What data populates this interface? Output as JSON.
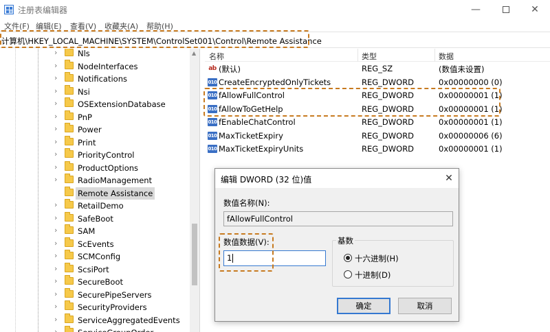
{
  "window": {
    "title": "注册表编辑器",
    "minimize": "—",
    "close": "✕"
  },
  "menu": [
    "文件(F)",
    "编辑(E)",
    "查看(V)",
    "收藏夹(A)",
    "帮助(H)"
  ],
  "address": "计算机\\HKEY_LOCAL_MACHINE\\SYSTEM\\ControlSet001\\Control\\Remote Assistance",
  "tree": {
    "items": [
      {
        "label": "Nls",
        "selected": false
      },
      {
        "label": "NodeInterfaces",
        "selected": false
      },
      {
        "label": "Notifications",
        "selected": false
      },
      {
        "label": "Nsi",
        "selected": false
      },
      {
        "label": "OSExtensionDatabase",
        "selected": false
      },
      {
        "label": "PnP",
        "selected": false
      },
      {
        "label": "Power",
        "selected": false
      },
      {
        "label": "Print",
        "selected": false
      },
      {
        "label": "PriorityControl",
        "selected": false
      },
      {
        "label": "ProductOptions",
        "selected": false
      },
      {
        "label": "RadioManagement",
        "selected": false
      },
      {
        "label": "Remote Assistance",
        "selected": true
      },
      {
        "label": "RetailDemo",
        "selected": false
      },
      {
        "label": "SafeBoot",
        "selected": false
      },
      {
        "label": "SAM",
        "selected": false
      },
      {
        "label": "ScEvents",
        "selected": false
      },
      {
        "label": "SCMConfig",
        "selected": false
      },
      {
        "label": "ScsiPort",
        "selected": false
      },
      {
        "label": "SecureBoot",
        "selected": false
      },
      {
        "label": "SecurePipeServers",
        "selected": false
      },
      {
        "label": "SecurityProviders",
        "selected": false
      },
      {
        "label": "ServiceAggregatedEvents",
        "selected": false
      },
      {
        "label": "ServiceGroupOrder",
        "selected": false
      }
    ]
  },
  "list": {
    "headers": {
      "name": "名称",
      "type": "类型",
      "data": "数据"
    },
    "rows": [
      {
        "icon": "string-value-icon",
        "icon_text": "ab",
        "name": "(默认)",
        "type": "REG_SZ",
        "data": "(数值未设置)"
      },
      {
        "icon": "binary-value-icon",
        "icon_text": "010",
        "name": "CreateEncryptedOnlyTickets",
        "type": "REG_DWORD",
        "data": "0x00000000 (0)"
      },
      {
        "icon": "binary-value-icon",
        "icon_text": "010",
        "name": "fAllowFullControl",
        "type": "REG_DWORD",
        "data": "0x00000001 (1)"
      },
      {
        "icon": "binary-value-icon",
        "icon_text": "010",
        "name": "fAllowToGetHelp",
        "type": "REG_DWORD",
        "data": "0x00000001 (1)"
      },
      {
        "icon": "binary-value-icon",
        "icon_text": "010",
        "name": "fEnableChatControl",
        "type": "REG_DWORD",
        "data": "0x00000001 (1)"
      },
      {
        "icon": "binary-value-icon",
        "icon_text": "010",
        "name": "MaxTicketExpiry",
        "type": "REG_DWORD",
        "data": "0x00000006 (6)"
      },
      {
        "icon": "binary-value-icon",
        "icon_text": "010",
        "name": "MaxTicketExpiryUnits",
        "type": "REG_DWORD",
        "data": "0x00000001 (1)"
      }
    ]
  },
  "dialog": {
    "title": "编辑 DWORD (32 位)值",
    "close": "✕",
    "name_label": "数值名称(N):",
    "name_value": "fAllowFullControl",
    "data_label": "数值数据(V):",
    "data_value": "1",
    "radix_label": "基数",
    "radix_hex": "十六进制(H)",
    "radix_dec": "十进制(D)",
    "radix_selected": "hex",
    "ok": "确定",
    "cancel": "取消"
  },
  "colors": {
    "highlight_dashes": "#c77a1f",
    "selection": "#d9d9d9",
    "focus_border": "#3478d0"
  }
}
